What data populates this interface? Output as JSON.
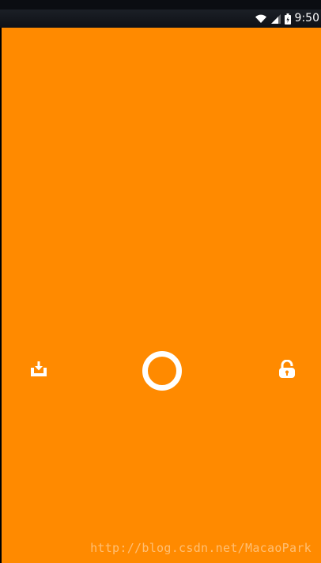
{
  "status_bar": {
    "time": "9:50",
    "icons": [
      "wifi-icon",
      "cell-signal-icon",
      "battery-icon"
    ]
  },
  "lock_screen": {
    "background_color": "#ff8a00",
    "center_control": "ring-unlock-handle",
    "left_target_icon": "download-tray-icon",
    "right_target_icon": "unlock-padlock-icon"
  },
  "watermark": {
    "text": "http://blog.csdn.net/MacaoPark"
  }
}
